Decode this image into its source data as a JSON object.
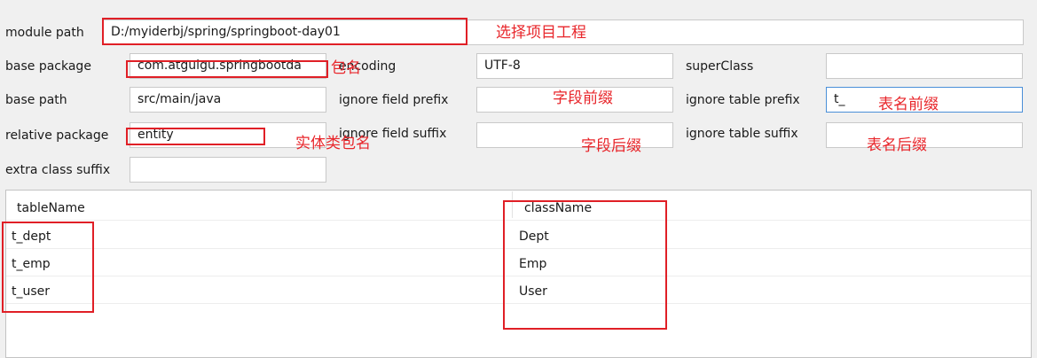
{
  "form": {
    "module_path": {
      "label": "module path",
      "value": "D:/myiderbj/spring/springboot-day01"
    },
    "base_package": {
      "label": "base package",
      "value": "com.atguigu.springbootda"
    },
    "encoding": {
      "label": "encoding",
      "value": "UTF-8"
    },
    "super_class": {
      "label": "superClass",
      "value": ""
    },
    "base_path": {
      "label": "base path",
      "value": "src/main/java"
    },
    "ignore_field_prefix": {
      "label": "ignore field prefix",
      "value": ""
    },
    "ignore_table_prefix": {
      "label": "ignore table prefix",
      "value": "t_"
    },
    "relative_package": {
      "label": "relative package",
      "value": "entity"
    },
    "ignore_field_suffix": {
      "label": "ignore field suffix",
      "value": ""
    },
    "ignore_table_suffix": {
      "label": "ignore table suffix",
      "value": ""
    },
    "extra_class_suffix": {
      "label": "extra class suffix",
      "value": ""
    }
  },
  "annotations": {
    "select_project": "选择项目工程",
    "package_name": "包名",
    "field_prefix": "字段前缀",
    "table_prefix": "表名前缀",
    "entity_package": "实体类包名",
    "field_suffix": "字段后缀",
    "table_suffix": "表名后缀",
    "color": "#e8262b"
  },
  "table": {
    "columns": [
      "tableName",
      "className"
    ],
    "rows": [
      {
        "tableName": "t_dept",
        "className": "Dept"
      },
      {
        "tableName": "t_emp",
        "className": "Emp"
      },
      {
        "tableName": "t_user",
        "className": "User"
      }
    ]
  }
}
